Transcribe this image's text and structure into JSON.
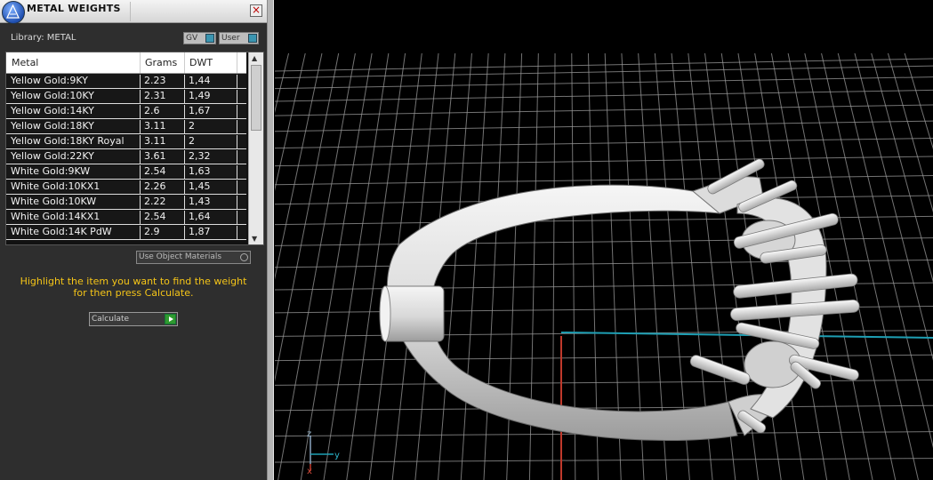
{
  "panel": {
    "title": "METAL WEIGHTS",
    "library_label": "Library: METAL",
    "toggle_gv": "GV",
    "toggle_user": "User",
    "columns": [
      "Metal",
      "Grams",
      "DWT"
    ],
    "rows": [
      {
        "metal": "Yellow Gold:9KY",
        "grams": "2.23",
        "dwt": "1,44"
      },
      {
        "metal": "Yellow Gold:10KY",
        "grams": "2.31",
        "dwt": "1,49"
      },
      {
        "metal": "Yellow Gold:14KY",
        "grams": "2.6",
        "dwt": "1,67"
      },
      {
        "metal": "Yellow Gold:18KY",
        "grams": "3.11",
        "dwt": "2"
      },
      {
        "metal": "Yellow Gold:18KY Royal",
        "grams": "3.11",
        "dwt": "2"
      },
      {
        "metal": "Yellow Gold:22KY",
        "grams": "3.61",
        "dwt": "2,32"
      },
      {
        "metal": "White Gold:9KW",
        "grams": "2.54",
        "dwt": "1,63"
      },
      {
        "metal": "White Gold:10KX1",
        "grams": "2.26",
        "dwt": "1,45"
      },
      {
        "metal": "White Gold:10KW",
        "grams": "2.22",
        "dwt": "1,43"
      },
      {
        "metal": "White Gold:14KX1",
        "grams": "2.54",
        "dwt": "1,64"
      },
      {
        "metal": "White Gold:14K PdW",
        "grams": "2.9",
        "dwt": "1,87"
      }
    ],
    "use_object_materials": "Use Object Materials",
    "help_text_1": "Highlight the item you want to find the weight",
    "help_text_2": "for then press Calculate.",
    "calculate_label": "Calculate"
  },
  "viewport": {
    "axis_labels": {
      "z": "z",
      "y": "y",
      "x": "x"
    },
    "colors": {
      "grid": "#9a9a9a",
      "axis_x": "#c0392b",
      "axis_y": "#1e9fb4",
      "ring": "#e6e6e6"
    }
  }
}
